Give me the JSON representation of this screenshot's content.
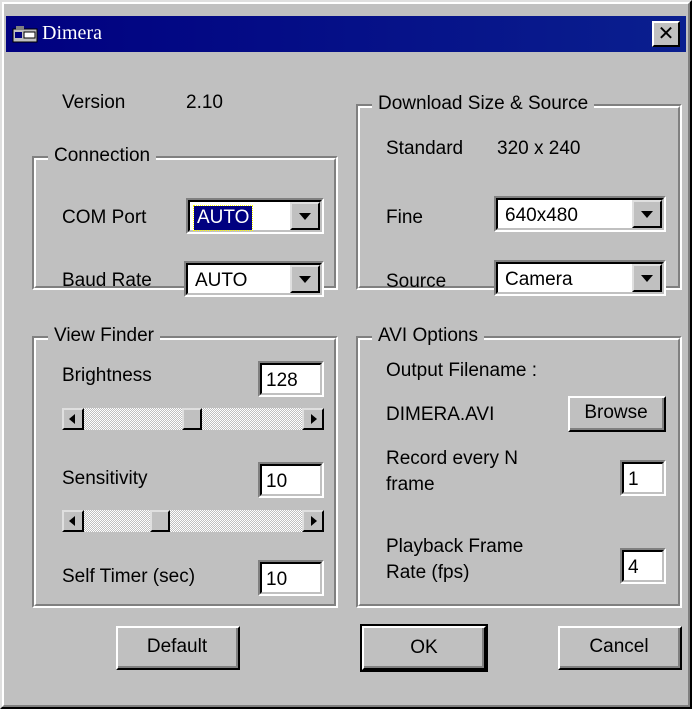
{
  "window": {
    "title": "Dimera",
    "icon": "camera-icon",
    "close": "close-icon",
    "close_glyph": "✕"
  },
  "version": {
    "label": "Version",
    "value": "2.10"
  },
  "connection": {
    "legend": "Connection",
    "com_port": {
      "label": "COM Port",
      "value": "AUTO"
    },
    "baud_rate": {
      "label": "Baud Rate",
      "value": "AUTO"
    }
  },
  "download": {
    "legend": "Download Size & Source",
    "standard": {
      "label": "Standard",
      "value": "320 x 240"
    },
    "fine": {
      "label": "Fine",
      "value": "640x480"
    },
    "source": {
      "label": "Source",
      "value": "Camera"
    }
  },
  "view_finder": {
    "legend": "View Finder",
    "brightness": {
      "label": "Brightness",
      "value": "128"
    },
    "sensitivity": {
      "label": "Sensitivity",
      "value": "10"
    },
    "self_timer": {
      "label": "Self Timer (sec)",
      "value": "10"
    }
  },
  "avi": {
    "legend": "AVI Options",
    "output_label": "Output Filename :",
    "filename": "DIMERA.AVI",
    "browse": "Browse",
    "record_label_1": "Record every N",
    "record_label_2": "frame",
    "record_value": "1",
    "playback_label_1": "Playback Frame",
    "playback_label_2": "Rate (fps)",
    "playback_value": "4"
  },
  "buttons": {
    "default": "Default",
    "ok": "OK",
    "cancel": "Cancel"
  }
}
